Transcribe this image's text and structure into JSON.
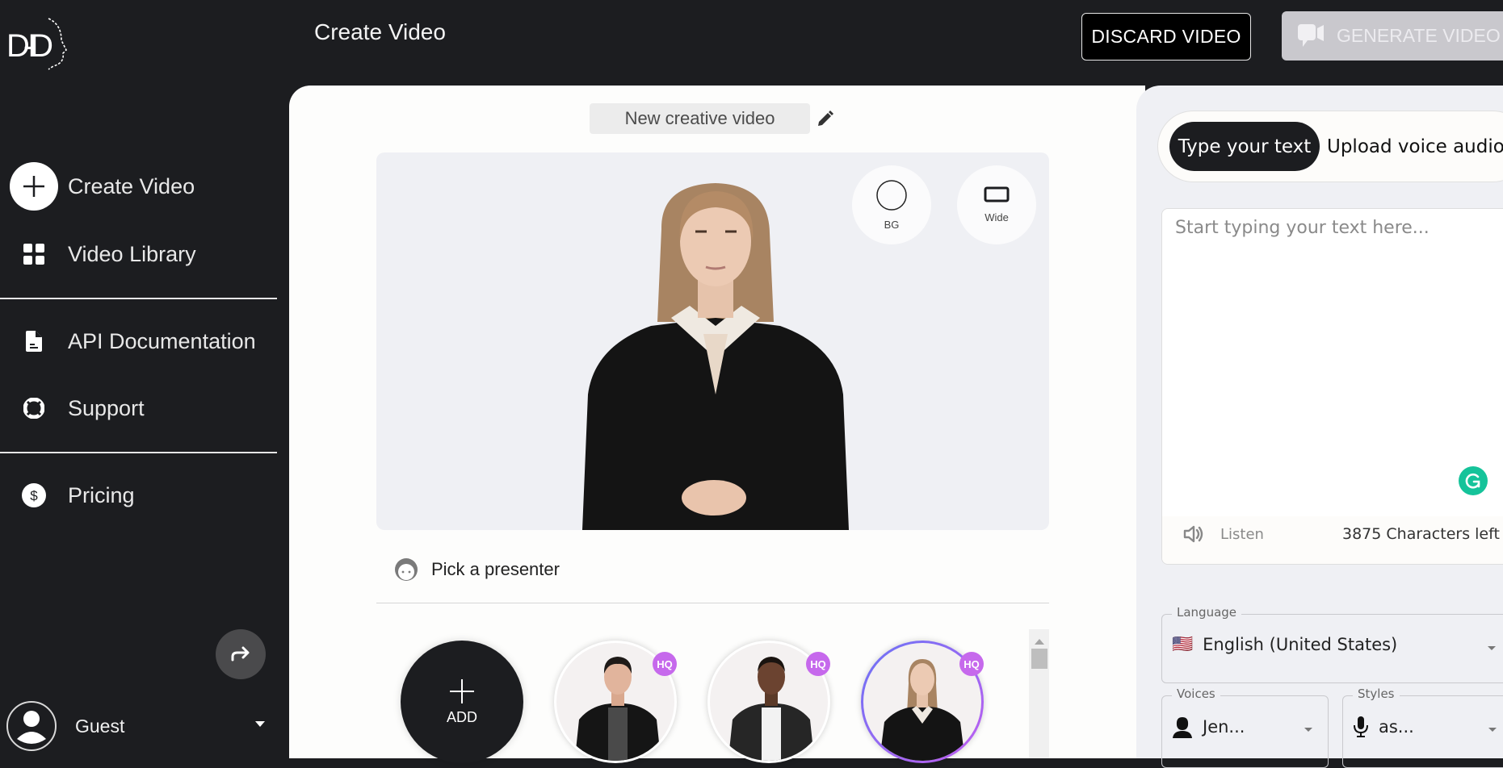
{
  "app": {
    "logo_text": "D-ID"
  },
  "header": {
    "title": "Create Video",
    "discard_label": "DISCARD VIDEO",
    "generate_label": "GENERATE VIDEO"
  },
  "sidebar": {
    "items": [
      {
        "label": "Create Video",
        "icon": "plus-icon"
      },
      {
        "label": "Video Library",
        "icon": "grid-icon"
      },
      {
        "label": "API Documentation",
        "icon": "document-icon"
      },
      {
        "label": "Support",
        "icon": "lifebuoy-icon"
      },
      {
        "label": "Pricing",
        "icon": "dollar-icon"
      }
    ],
    "user": {
      "name": "Guest"
    }
  },
  "editor": {
    "video_title": "New creative video",
    "bg_label": "BG",
    "wide_label": "Wide",
    "pick_presenter_label": "Pick a presenter",
    "add_label": "ADD",
    "presenters": [
      {
        "badge": "HQ",
        "selected": false
      },
      {
        "badge": "HQ",
        "selected": false
      },
      {
        "badge": "HQ",
        "selected": true
      }
    ]
  },
  "script": {
    "tabs": [
      {
        "label": "Type your text",
        "active": true
      },
      {
        "label": "Upload voice audio",
        "active": false
      }
    ],
    "placeholder": "Start typing your text here...",
    "listen_label": "Listen",
    "chars_left": "3875 Characters left",
    "language": {
      "label": "Language",
      "value": "English (United States)",
      "flag": "🇺🇸"
    },
    "voices": {
      "label": "Voices",
      "value": "Jen..."
    },
    "styles": {
      "label": "Styles",
      "value": "as..."
    }
  },
  "colors": {
    "sidebar_bg": "#1c1d20",
    "accent_hq": "#c669ec",
    "grammarly": "#15c39a",
    "generate_disabled": "#c9c8cd"
  }
}
